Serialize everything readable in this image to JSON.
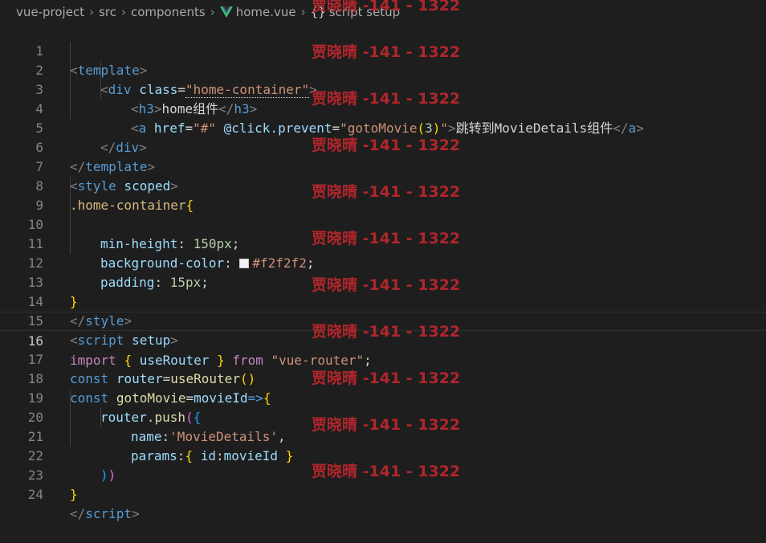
{
  "breadcrumb": {
    "items": [
      "vue-project",
      "src",
      "components",
      "home.vue",
      "script setup"
    ],
    "braces": "{}"
  },
  "editor": {
    "line_numbers": [
      "1",
      "2",
      "3",
      "4",
      "5",
      "6",
      "7",
      "8",
      "9",
      "10",
      "11",
      "12",
      "13",
      "14",
      "15",
      "16",
      "17",
      "18",
      "19",
      "20",
      "21",
      "22",
      "23",
      "24"
    ],
    "current_line": "16",
    "tokens": {
      "l1": [
        "<",
        "template",
        ">"
      ],
      "l2": [
        "<",
        "div",
        " ",
        "class",
        "=",
        "\"home-container\"",
        ">"
      ],
      "l3": [
        "<",
        "h3",
        ">",
        "home组件",
        "</",
        "h3",
        ">"
      ],
      "l4": [
        "<",
        "a",
        " ",
        "href",
        "=",
        "\"#\"",
        " ",
        "@click.prevent",
        "=",
        "\"gotoMovie",
        "(",
        "3",
        ")",
        "\"",
        ">",
        "跳转到MovieDetails组件",
        "</",
        "a",
        ">"
      ],
      "l5": [
        "</",
        "div",
        ">"
      ],
      "l6": [
        "</",
        "template",
        ">"
      ],
      "l7": [
        "<",
        "style",
        " ",
        "scoped",
        ">"
      ],
      "l8": [
        ".home-container",
        "{"
      ],
      "l10": [
        "min-height",
        ": ",
        "150px",
        ";"
      ],
      "l11": [
        "background-color",
        ": ",
        "#f2f2f2",
        ";"
      ],
      "l12": [
        "padding",
        ": ",
        "15px",
        ";"
      ],
      "l13": [
        "}"
      ],
      "l14": [
        "</",
        "style",
        ">"
      ],
      "l15": [
        "<",
        "script",
        " ",
        "setup",
        ">"
      ],
      "l16": [
        "import",
        " ",
        "{",
        " ",
        "useRouter",
        " ",
        "}",
        " ",
        "from",
        " ",
        "\"vue-router\"",
        ";"
      ],
      "l17": [
        "const",
        " ",
        "router",
        "=",
        "useRouter",
        "(",
        ")"
      ],
      "l18": [
        "const",
        " ",
        "gotoMovie",
        "=",
        "movieId",
        "=>",
        "{"
      ],
      "l19": [
        "router",
        ".",
        "push",
        "(",
        "{"
      ],
      "l20": [
        "name",
        ":",
        "'MovieDetails'",
        ","
      ],
      "l21": [
        "params",
        ":",
        "{",
        " ",
        "id",
        ":",
        "movieId",
        " ",
        "}"
      ],
      "l22": [
        ")",
        ")"
      ],
      "l23": [
        "}"
      ],
      "l24": [
        "</",
        "script",
        ">"
      ]
    }
  },
  "watermark": {
    "text": "贾晓晴 -141 - 1322",
    "color": "#c0272d"
  }
}
